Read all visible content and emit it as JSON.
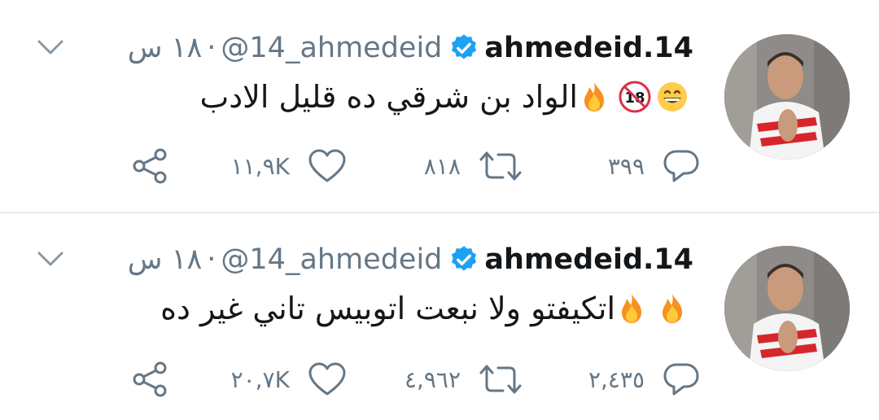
{
  "tweets": [
    {
      "name": "ahmedeid.14",
      "handle": "@14_ahmedeid",
      "dot": "·",
      "time": "١٨ س",
      "text": "الواد بن شرقي ده قليل الادب",
      "emojis": [
        "fire-emoji",
        "no-under-18-emoji",
        "grinning-face-emoji"
      ],
      "reply_count": "٣٩٩",
      "retweet_count": "٨١٨",
      "like_count": "١١,٩K"
    },
    {
      "name": "ahmedeid.14",
      "handle": "@14_ahmedeid",
      "dot": "·",
      "time": "١٨ س",
      "text": "اتكيفتو ولا نبعت اتوبيس تاني غير ده",
      "emojis": [
        "fire-emoji",
        "fire-emoji"
      ],
      "reply_count": "٢,٤٣٥",
      "retweet_count": "٤,٩٦٢",
      "like_count": "٢٠,٧K"
    }
  ],
  "colors": {
    "verified": "#1da1f2",
    "secondary_text": "#657786",
    "primary_text": "#14171a",
    "divider": "#e6ecf0"
  },
  "icons": {
    "reply": "reply-icon",
    "retweet": "retweet-icon",
    "like": "heart-icon",
    "share": "share-icon",
    "menu": "chevron-down-icon",
    "verified": "verified-badge-icon"
  }
}
